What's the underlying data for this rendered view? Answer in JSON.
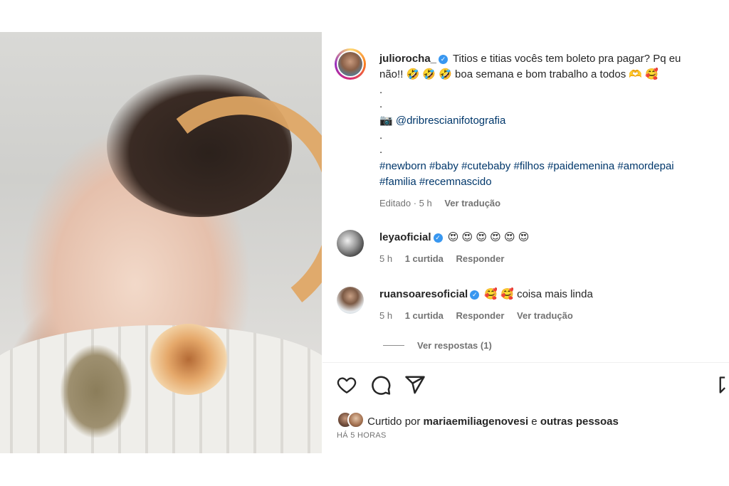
{
  "post": {
    "author": "juliorocha_",
    "caption_line1": "Titios e titias vocês tem boleto pra pagar? Pq eu",
    "caption_line2": "não!! 🤣 🤣 🤣  boa semana e bom trabalho a todos 🫶 🥰",
    "dot": ".",
    "camera_emoji": "📷",
    "photographer": "@dribrescianifotografia",
    "hashtags_line1": "#newborn #baby #cutebaby #filhos #paidemenina #amordepai",
    "hashtags_line2": "#familia #recemnascido",
    "edited": "Editado · 5 h",
    "translate": "Ver tradução"
  },
  "comments": [
    {
      "username": "leyaoficial",
      "text": "😍 😍 😍 😍 😍 😍",
      "time": "5 h",
      "likes": "1 curtida",
      "reply": "Responder"
    },
    {
      "username": "ruansoaresoficial",
      "text": "🥰 🥰 coisa mais linda",
      "time": "5 h",
      "likes": "1 curtida",
      "reply": "Responder",
      "translate": "Ver tradução",
      "view_replies": "Ver respostas (1)"
    }
  ],
  "footer": {
    "liked_prefix": "Curtido por",
    "liked_user": "mariaemiliagenovesi",
    "liked_and": "e",
    "liked_others": "outras pessoas",
    "time_ago": "HÁ 5 HORAS"
  },
  "icons": [
    "heart-icon",
    "comment-icon",
    "share-icon",
    "bookmark-icon",
    "verified-badge-icon"
  ],
  "colors": {
    "link": "#00376b",
    "verified": "#3897f0",
    "meta": "#737373"
  }
}
